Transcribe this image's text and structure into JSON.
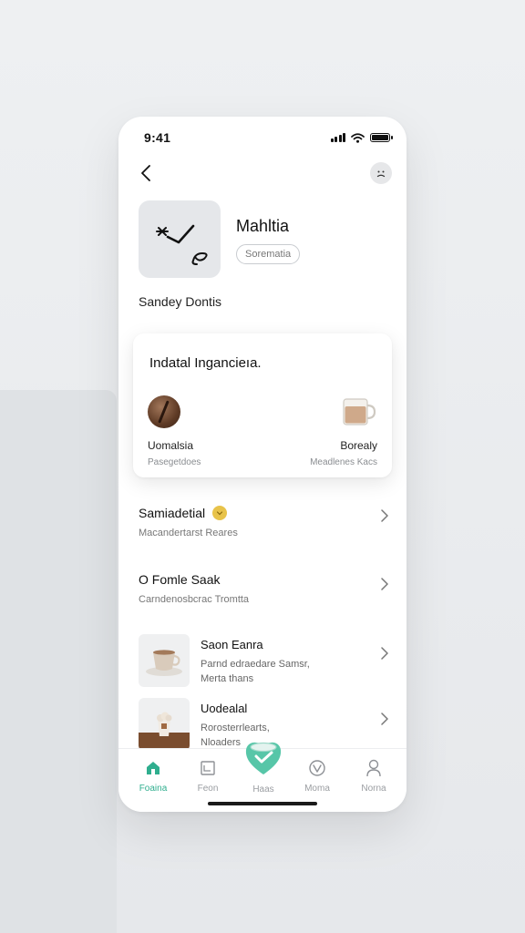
{
  "status_bar": {
    "time": "9:41"
  },
  "profile": {
    "name": "Mahltia",
    "pill_label": "Sorematia",
    "subtitle": "Sandey Dontis"
  },
  "card": {
    "title": "Indatal Ingancieıa.",
    "items": [
      {
        "label": "Uomalsia",
        "sub": "Pasegetdoes"
      },
      {
        "label": "Borealy",
        "sub": "Meadlenes Kacs"
      }
    ]
  },
  "list": [
    {
      "title": "Samiadetial",
      "sub": "Macandertarst Reares"
    },
    {
      "title": "O Fomle Saak",
      "sub": "Carndenosbcrac Tromtta"
    }
  ],
  "thumb_list": [
    {
      "title": "Saon Eanra",
      "sub_line1": "Parnd edraedare Samsr,",
      "sub_line2": "Merta thans"
    },
    {
      "title": "Uodealal",
      "sub_line1": "Rorosterrlearts,",
      "sub_line2": "Nloaders"
    }
  ],
  "tabs": [
    {
      "label": "Foaina",
      "icon": "home-icon",
      "active": true
    },
    {
      "label": "Feon",
      "icon": "document-icon",
      "active": false
    },
    {
      "label": "Haas",
      "icon": "heart-cup-icon",
      "active": false
    },
    {
      "label": "Moma",
      "icon": "check-circle-icon",
      "active": false
    },
    {
      "label": "Norna",
      "icon": "user-icon",
      "active": false
    }
  ],
  "colors": {
    "accent": "#2fae8e",
    "badge": "#e8c34a",
    "background": "#eef0f2"
  }
}
